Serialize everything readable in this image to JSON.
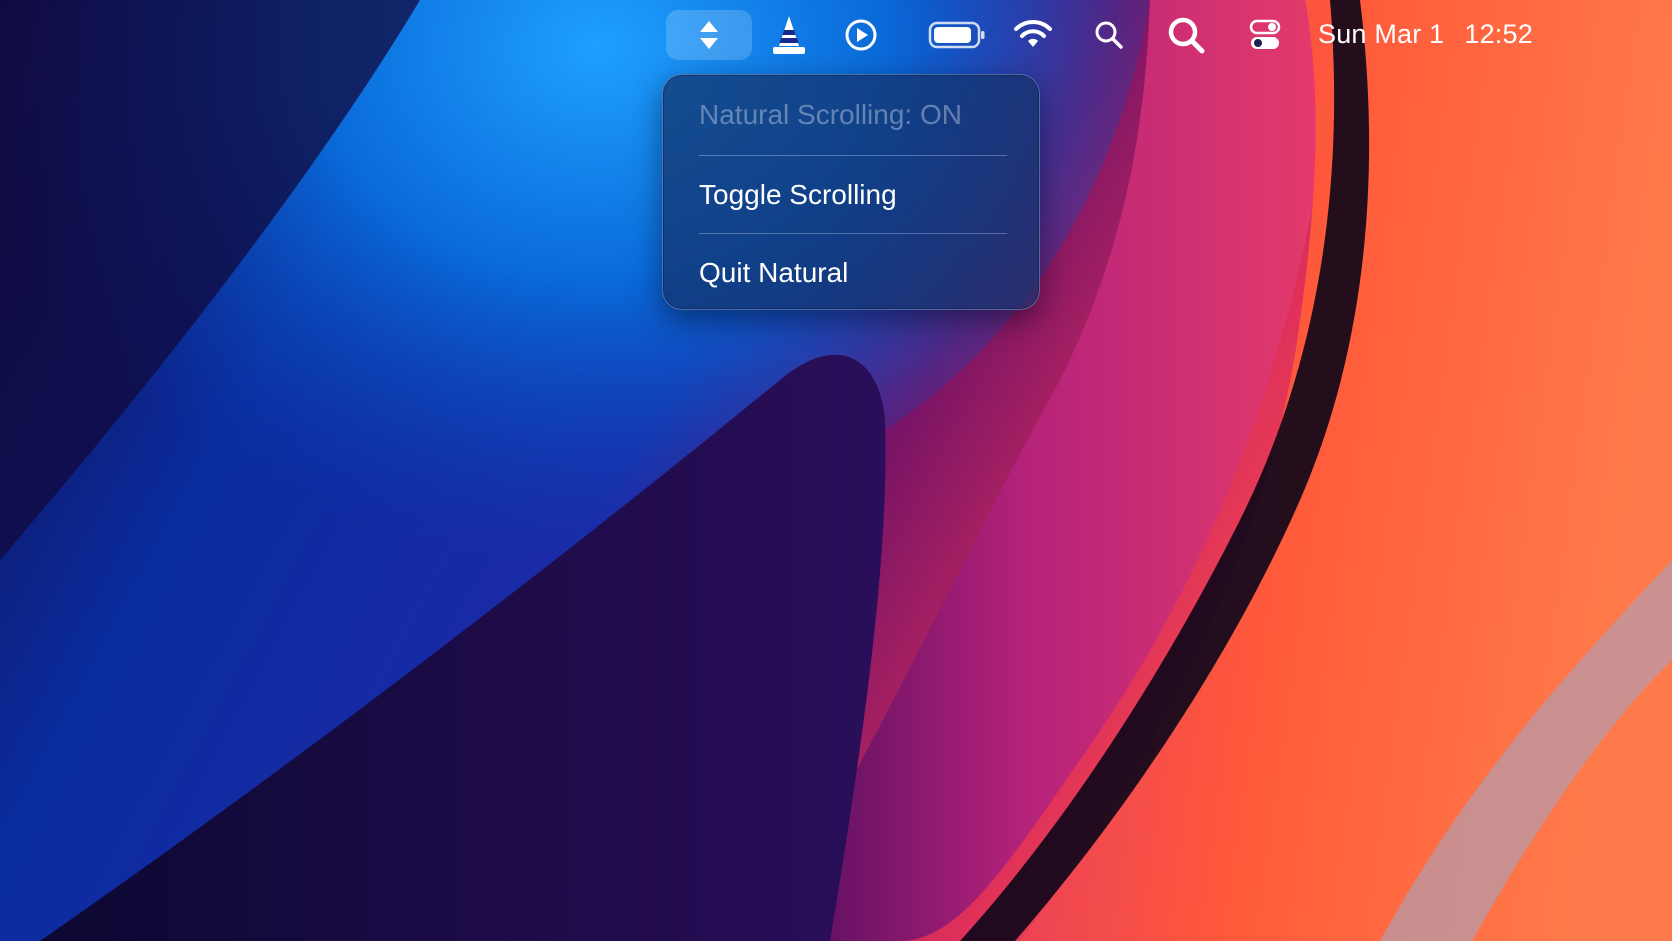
{
  "menubar": {
    "status_items": [
      {
        "icon": "scroll-arrows-icon",
        "active": true
      },
      {
        "icon": "vlc-cone-icon"
      },
      {
        "icon": "play-circle-icon"
      },
      {
        "icon": "battery-icon"
      },
      {
        "icon": "wifi-icon"
      },
      {
        "icon": "small-search-icon"
      },
      {
        "icon": "spotlight-search-icon"
      },
      {
        "icon": "control-center-icon"
      }
    ],
    "clock": {
      "date": "Sun Mar 1",
      "time": "12:52"
    }
  },
  "dropdown_menu": {
    "status_label": "Natural Scrolling: ON",
    "items": [
      {
        "label": "Toggle Scrolling"
      },
      {
        "label": "Quit Natural"
      }
    ]
  },
  "colors": {
    "menu_background": "#143269",
    "wallpaper_blue": "#0a6ad9",
    "wallpaper_dark": "#160a36",
    "wallpaper_magenta": "#c0287a",
    "wallpaper_orange": "#ff5a32"
  }
}
